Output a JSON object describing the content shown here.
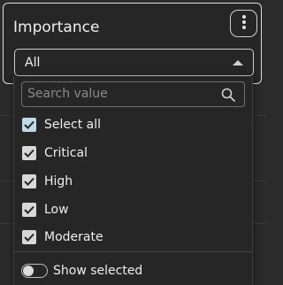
{
  "header": {
    "title": "Importance",
    "menu_icon": "kebab-vertical-icon"
  },
  "select": {
    "value": "All",
    "caret_icon": "caret-up-icon"
  },
  "dropdown": {
    "search": {
      "placeholder": "Search value",
      "value": "",
      "icon": "search-icon"
    },
    "select_all": {
      "label": "Select all",
      "checked": true
    },
    "options": [
      {
        "label": "Critical",
        "checked": true
      },
      {
        "label": "High",
        "checked": true
      },
      {
        "label": "Low",
        "checked": true
      },
      {
        "label": "Moderate",
        "checked": true
      }
    ],
    "show_selected": {
      "label": "Show selected",
      "on": false
    }
  },
  "colors": {
    "background": "#2b2b2b",
    "panel": "#262626",
    "text": "#eeeeee",
    "checkbox": "#d8d8d8",
    "select_all_checkbox": "#bcd9e6",
    "check_mark": "#262626",
    "border": "#cfcfcf"
  }
}
